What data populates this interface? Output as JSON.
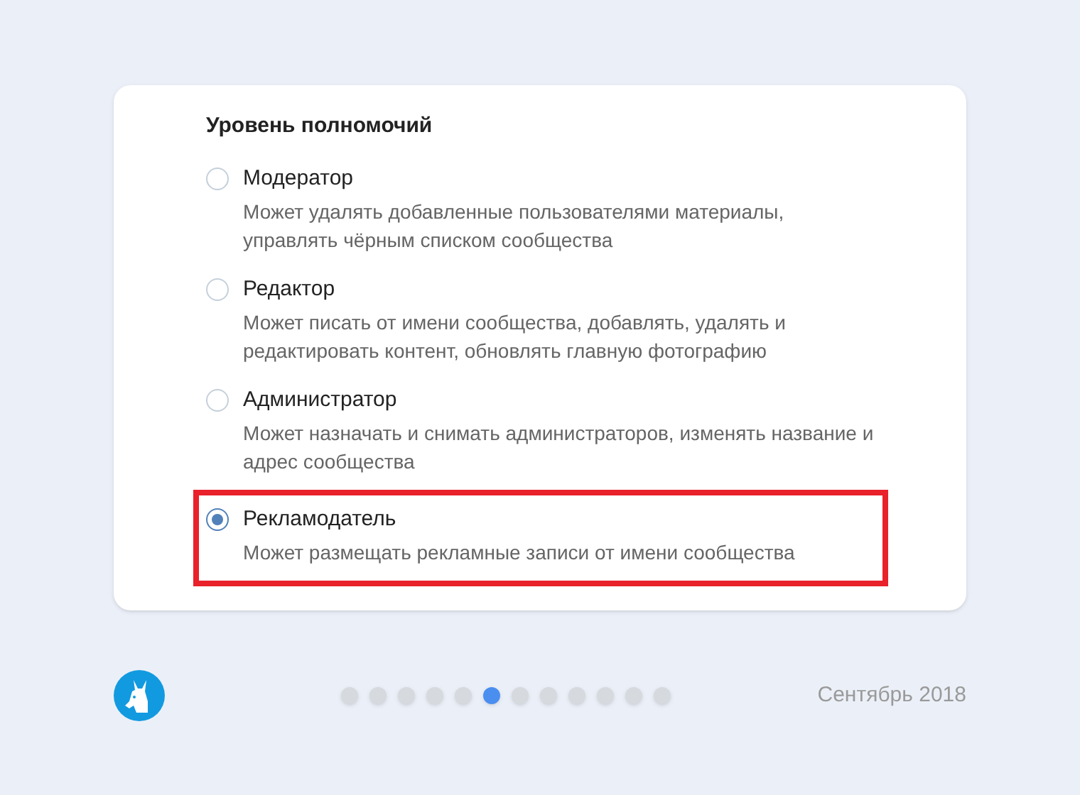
{
  "section_title": "Уровень полномочий",
  "options": [
    {
      "label": "Модератор",
      "description": "Может удалять добавленные пользователями материалы, управлять чёрным списком сообщества",
      "selected": false,
      "highlighted": false
    },
    {
      "label": "Редактор",
      "description": "Может писать от имени сообщества, добавлять, удалять и редактировать контент, обновлять главную фотографию",
      "selected": false,
      "highlighted": false
    },
    {
      "label": "Администратор",
      "description": "Может назначать и снимать администраторов, изменять название и адрес сообщества",
      "selected": false,
      "highlighted": false
    },
    {
      "label": "Рекламодатель",
      "description": "Может размещать рекламные записи от имени сообщества",
      "selected": true,
      "highlighted": true
    }
  ],
  "pagination": [
    {
      "selected": false
    },
    {
      "selected": false
    },
    {
      "selected": false
    },
    {
      "selected": false
    },
    {
      "selected": false
    },
    {
      "selected": true
    },
    {
      "selected": false
    },
    {
      "selected": false
    },
    {
      "selected": false
    },
    {
      "selected": false
    },
    {
      "selected": false
    },
    {
      "selected": false
    }
  ],
  "date": "Сентябрь 2018"
}
